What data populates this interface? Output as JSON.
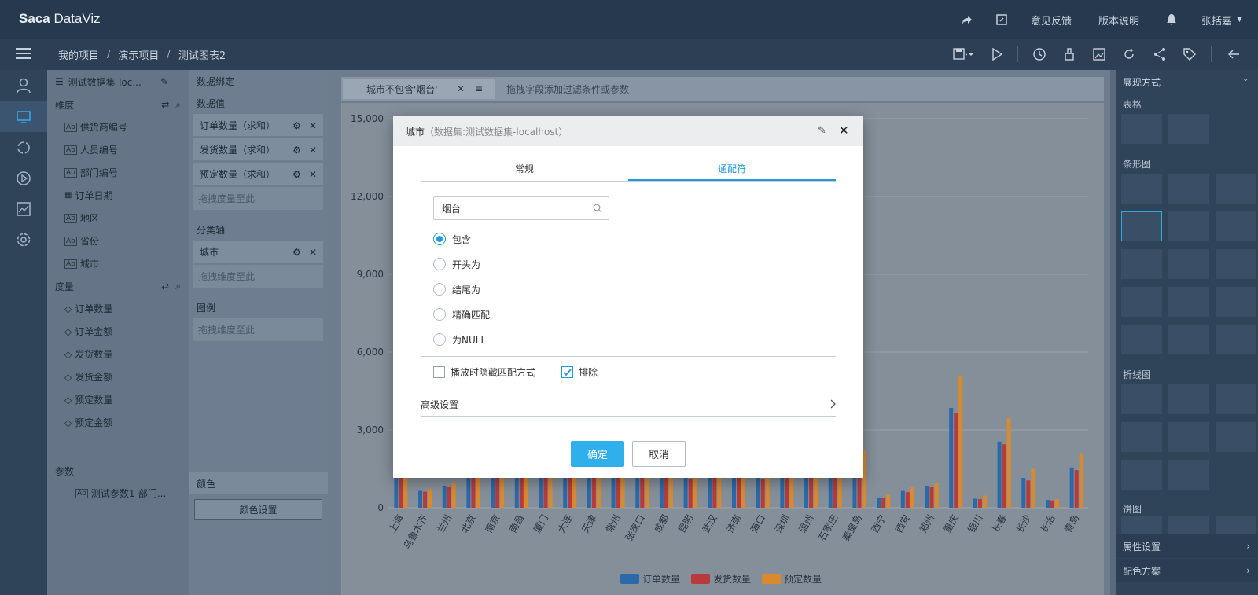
{
  "topbar": {
    "logo_a": "Sa",
    "logo_b": "ca",
    "logo_c": " DataViz",
    "feedback": "意见反馈",
    "version_notes": "版本说明",
    "user": "张括嘉"
  },
  "breadcrumb": [
    "我的项目",
    "演示项目",
    "测试图表2"
  ],
  "dataset": {
    "name": "测试数据集-loc...",
    "dimensions_label": "维度",
    "dimensions": [
      "供货商编号",
      "人员编号",
      "部门编号",
      "订单日期",
      "地区",
      "省份",
      "城市"
    ],
    "measures_label": "度量",
    "measures": [
      "订单数量",
      "订单金额",
      "发货数量",
      "发货金额",
      "预定数量",
      "预定金额"
    ],
    "params_label": "参数",
    "params": [
      "测试参数1-部门..."
    ]
  },
  "binding": {
    "title": "数据绑定",
    "values_label": "数据值",
    "values": [
      "订单数量（求和）",
      "发货数量（求和）",
      "预定数量（求和）"
    ],
    "values_drop": "拖拽度量至此",
    "axis_label": "分类轴",
    "axis": [
      "城市"
    ],
    "axis_drop": "拖拽维度至此",
    "legend_label": "图例",
    "legend_drop": "拖拽维度至此",
    "color_label": "颜色",
    "color_button": "颜色设置"
  },
  "filter": {
    "chip": "城市不包含'烟台'",
    "hint": "拖拽字段添加过滤条件或参数"
  },
  "chart_data": {
    "type": "bar",
    "categories": [
      "上海",
      "乌鲁木齐",
      "兰州",
      "北京",
      "南京",
      "南昌",
      "厦门",
      "大连",
      "天津",
      "常州",
      "张家口",
      "成都",
      "昆明",
      "武汉",
      "济南",
      "海口",
      "深圳",
      "温州",
      "石家庄",
      "秦皇岛",
      "西宁",
      "西安",
      "郑州",
      "重庆",
      "银川",
      "长春",
      "长沙",
      "长治",
      "青岛"
    ],
    "series": [
      {
        "name": "订单数量",
        "color": "#2a6aa8",
        "values": [
          1600,
          650,
          850,
          1600,
          1600,
          1600,
          1600,
          1600,
          1600,
          1600,
          1600,
          1600,
          1150,
          1250,
          1600,
          1150,
          1600,
          1600,
          1600,
          1600,
          400,
          650,
          850,
          3850,
          350,
          2550,
          1150,
          300,
          1550
        ]
      },
      {
        "name": "发货数量",
        "color": "#b93a3a",
        "values": [
          1400,
          620,
          800,
          1600,
          1600,
          1600,
          1600,
          1600,
          1600,
          1600,
          1600,
          1400,
          1100,
          1200,
          1600,
          1100,
          1600,
          1600,
          1600,
          1600,
          380,
          600,
          800,
          3650,
          330,
          2450,
          1050,
          280,
          1450
        ]
      },
      {
        "name": "预定数量",
        "color": "#d98a2e",
        "values": [
          1600,
          720,
          980,
          1600,
          1600,
          1600,
          1600,
          1600,
          1600,
          1600,
          1600,
          1600,
          1600,
          1600,
          1600,
          1600,
          1600,
          1600,
          1600,
          2200,
          500,
          780,
          950,
          5100,
          470,
          3450,
          1500,
          330,
          2100
        ]
      }
    ],
    "yticks": [
      "0",
      "3,000",
      "6,000",
      "9,000",
      "12,000",
      "15,000"
    ],
    "ylim": [
      0,
      15000
    ],
    "legend": [
      "订单数量",
      "发货数量",
      "预定数量"
    ],
    "legend_placement": "bottom-center"
  },
  "right_panel": {
    "title": "展现方式",
    "sections": [
      "表格",
      "条形图",
      "折线图",
      "饼图"
    ],
    "footer": [
      "属性设置",
      "配色方案"
    ]
  },
  "modal": {
    "title": "城市",
    "subtitle": "（数据集:测试数据集-localhost）",
    "tabs": [
      "常规",
      "通配符"
    ],
    "active_tab": "通配符",
    "search_value": "烟台",
    "options": [
      "包含",
      "开头为",
      "结尾为",
      "精确匹配",
      "为NULL"
    ],
    "selected_option": "包含",
    "hide_match_label": "播放时隐藏匹配方式",
    "exclude_label": "排除",
    "hide_match_checked": false,
    "exclude_checked": true,
    "advanced_label": "高级设置",
    "ok": "确定",
    "cancel": "取消",
    "accent": "#1e9be0"
  }
}
